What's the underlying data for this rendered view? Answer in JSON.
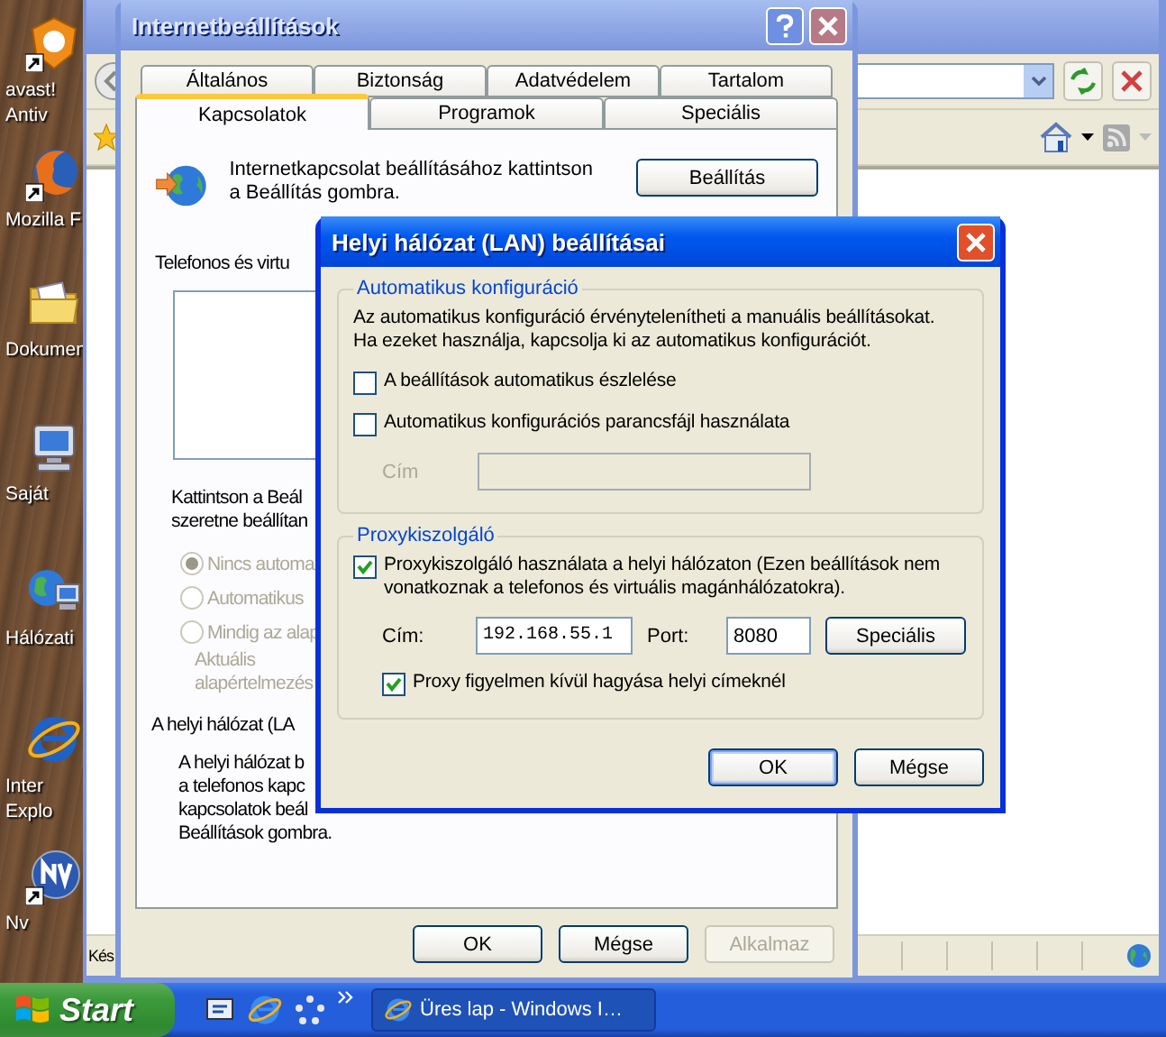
{
  "desktop_icons": [
    {
      "kind": "shield",
      "label": "avast!\nAntiv"
    },
    {
      "kind": "fox",
      "label": "Mozilla F"
    },
    {
      "kind": "folder",
      "label": "Dokumen"
    },
    {
      "kind": "computer",
      "label": "Saját"
    },
    {
      "kind": "network",
      "label": "Hálózati"
    },
    {
      "kind": "ie",
      "label": "Inter\nExplo"
    },
    {
      "kind": "app",
      "label": "Nv"
    }
  ],
  "browser": {
    "status": "Kés"
  },
  "options_dialog": {
    "title": "Internetbeállítások",
    "active": false,
    "tab_rows": [
      [
        {
          "label": "Általános",
          "selected": false
        },
        {
          "label": "Biztonság",
          "selected": false
        },
        {
          "label": "Adatvédelem",
          "selected": false
        },
        {
          "label": "Tartalom",
          "selected": false
        }
      ],
      [
        {
          "label": "Kapcsolatok",
          "selected": true
        },
        {
          "label": "Programok",
          "selected": false
        },
        {
          "label": "Speciális",
          "selected": false
        }
      ]
    ],
    "intro": "Internetkapcsolat beállításához kattintson\na Beállítás gombra.",
    "setup_button": "Beállítás",
    "dialup_label": "Telefonos és virtu",
    "dialup_hint": "Kattintson a Beál\nszeretne beállítan",
    "radios": [
      {
        "label": "Nincs automa",
        "selected": true,
        "disabled": true
      },
      {
        "label": "Automatikus",
        "selected": false,
        "disabled": true
      },
      {
        "label": "Mindig az alap",
        "selected": false,
        "disabled": true
      }
    ],
    "default_note": "Aktuális\nalapértelmezés",
    "lan_label": "A helyi hálózat (LA",
    "lan_text": "A helyi hálózat b\na telefonos kapc\nkapcsolatok beál\nBeállítások gombra.",
    "buttons": [
      {
        "label": "OK",
        "disabled": false
      },
      {
        "label": "Mégse",
        "disabled": false
      },
      {
        "label": "Alkalmaz",
        "disabled": true
      }
    ]
  },
  "lan_dialog": {
    "title": "Helyi hálózat (LAN) beállításai",
    "active": true,
    "auto_group": {
      "legend": "Automatikus konfiguráció",
      "note": "Az automatikus konfiguráció érvénytelenítheti a manuális beállításokat.\nHa ezeket használja, kapcsolja ki az automatikus konfigurációt.",
      "options": [
        {
          "label": "A beállítások automatikus észlelése",
          "checked": false
        },
        {
          "label": "Automatikus konfigurációs parancsfájl használata",
          "checked": false
        }
      ],
      "address_label": "Cím",
      "address_disabled": true
    },
    "proxy_group": {
      "legend": "Proxykiszolgáló",
      "use_proxy": {
        "label": "Proxykiszolgáló használata a helyi hálózaton (Ezen beállítások nem\nvonatkoznak a telefonos és virtuális magánhálózatokra).",
        "checked": true
      },
      "address_label": "Cím:",
      "address": "192.168.55.1",
      "port_label": "Port:",
      "port": "8080",
      "advanced_button": "Speciális",
      "bypass": {
        "label": "Proxy figyelmen kívül hagyása helyi címeknél",
        "checked": true
      }
    },
    "buttons": [
      {
        "label": "OK",
        "default": true
      },
      {
        "label": "Mégse",
        "default": false
      }
    ]
  },
  "taskbar": {
    "start": "Start",
    "tasks": [
      {
        "label": "Üres lap - Windows I…"
      }
    ]
  }
}
